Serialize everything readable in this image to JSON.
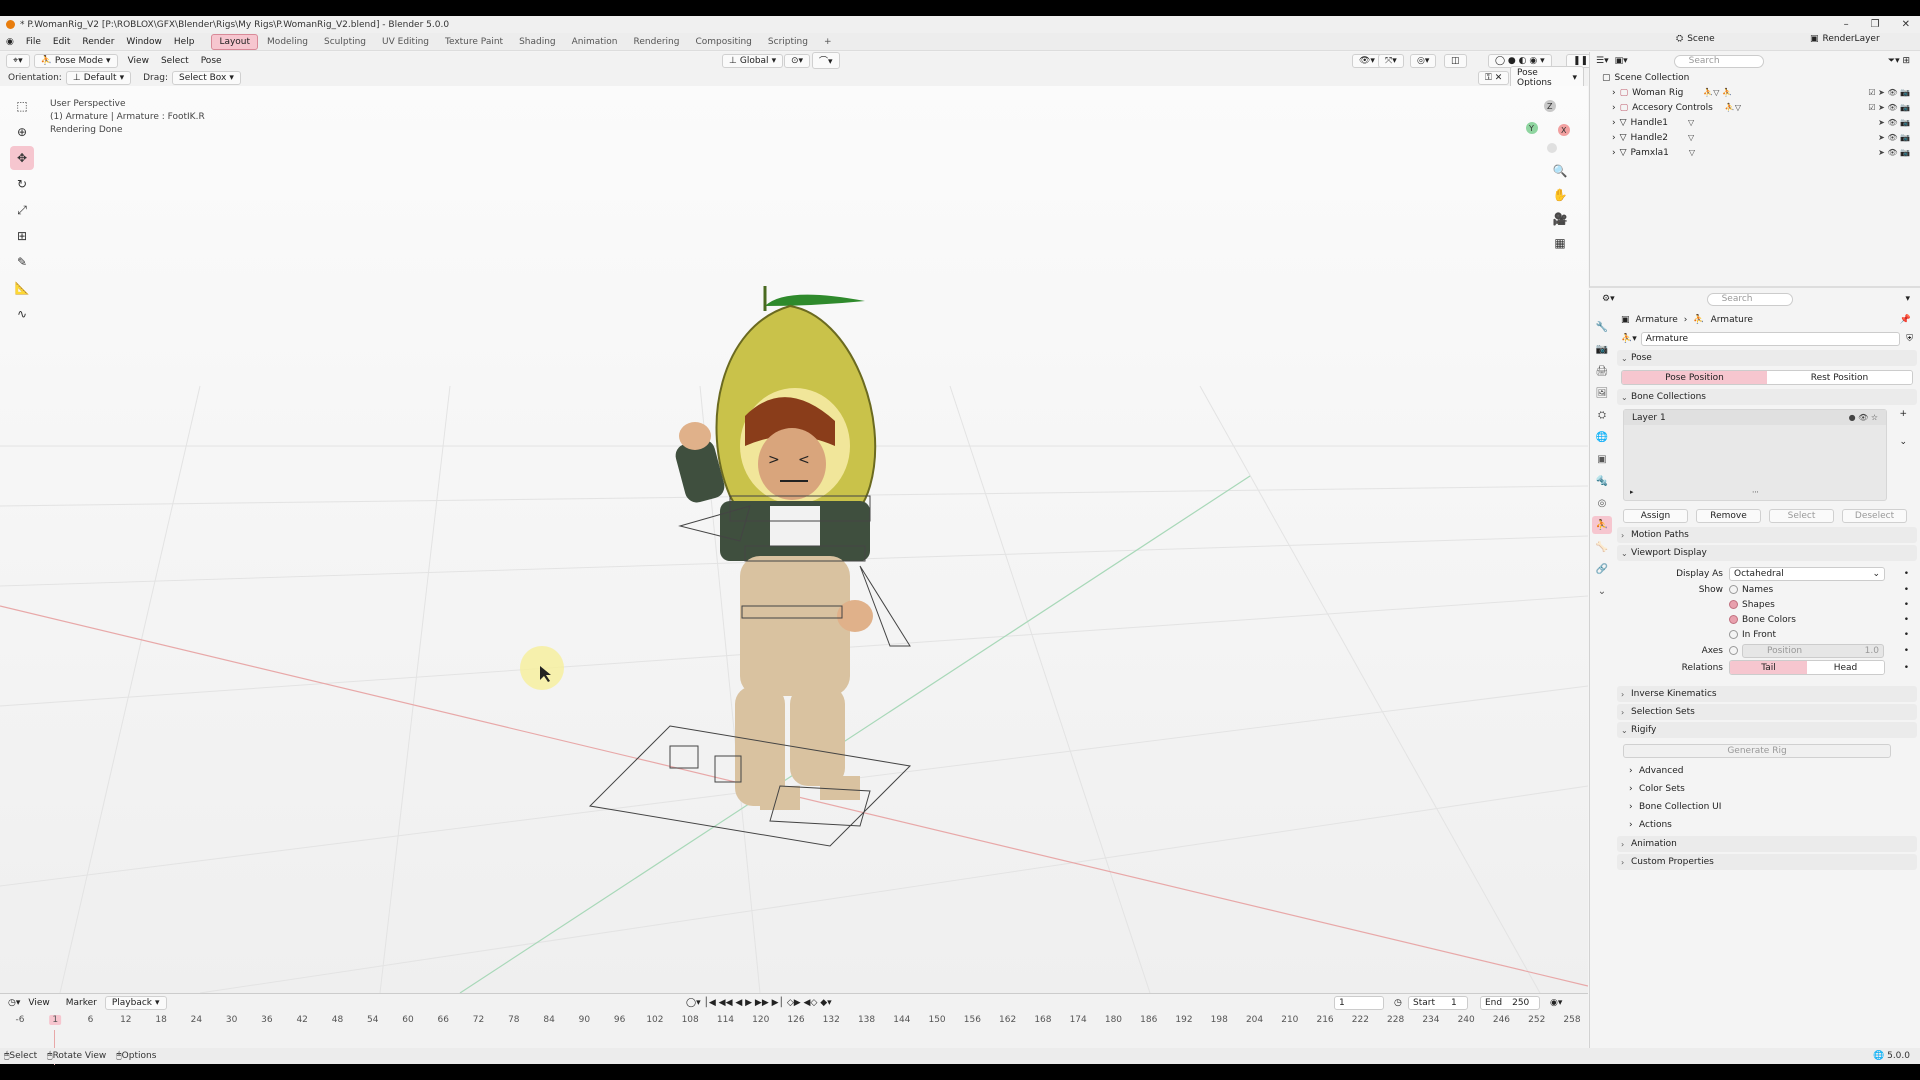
{
  "window": {
    "title": "* P.WomanRig_V2 [P:\\ROBLOX\\GFX\\Blender\\Rigs\\My Rigs\\P.WomanRig_V2.blend] - Blender 5.0.0",
    "controls": [
      "–",
      "❐",
      "✕"
    ]
  },
  "menu": {
    "items": [
      "File",
      "Edit",
      "Render",
      "Window",
      "Help"
    ],
    "workspaces": [
      "Layout",
      "Modeling",
      "Sculpting",
      "UV Editing",
      "Texture Paint",
      "Shading",
      "Animation",
      "Rendering",
      "Compositing",
      "Scripting"
    ],
    "active_workspace": "Layout",
    "scene": "Scene",
    "view_layer": "RenderLayer"
  },
  "viewport_header": {
    "mode": "Pose Mode",
    "menus": [
      "View",
      "Select",
      "Pose"
    ],
    "transform": "Global",
    "orientation_label": "Orientation:",
    "orientation_value": "Default",
    "drag_label": "Drag:",
    "drag_value": "Select Box",
    "pose_options": "Pose Options"
  },
  "viewport": {
    "line1": "User Perspective",
    "line2": "(1) Armature | Armature : FootIK.R",
    "line3": "Rendering Done",
    "gizmo_axes": [
      "Z",
      "Y",
      "X"
    ],
    "colors": {
      "x_axis": "#e8a8a8",
      "y_axis": "#a8d8b8",
      "accent": "#f6c6cf"
    }
  },
  "timeline": {
    "menus": [
      "View",
      "Marker",
      "Playback"
    ],
    "current_frame": "1",
    "start_label": "Start",
    "start": "1",
    "end_label": "End",
    "end": "250",
    "ticks": [
      "-6",
      "1",
      "6",
      "12",
      "18",
      "24",
      "30",
      "36",
      "42",
      "48",
      "54",
      "60",
      "66",
      "72",
      "78",
      "84",
      "90",
      "96",
      "102",
      "108",
      "114",
      "120",
      "126",
      "132",
      "138",
      "144",
      "150",
      "156",
      "162",
      "168",
      "174",
      "180",
      "186",
      "192",
      "198",
      "204",
      "210",
      "216",
      "222",
      "228",
      "234",
      "240",
      "246",
      "252",
      "258"
    ]
  },
  "status": {
    "select": "Select",
    "rotate": "Rotate View",
    "options": "Options",
    "version": "5.0.0"
  },
  "outliner": {
    "search_placeholder": "Search",
    "root": "Scene Collection",
    "items": [
      "Woman Rig",
      "Accesory Controls",
      "Handle1",
      "Handle2",
      "Pamxla1"
    ]
  },
  "properties": {
    "search_placeholder": "Search",
    "breadcrumb_object": "Armature",
    "breadcrumb_data": "Armature",
    "data_name": "Armature",
    "pose_panel": "Pose",
    "pose_position": "Pose Position",
    "rest_position": "Rest Position",
    "bone_collections": "Bone Collections",
    "layer1": "Layer 1",
    "assign": "Assign",
    "remove": "Remove",
    "select": "Select",
    "deselect": "Deselect",
    "motion_paths": "Motion Paths",
    "viewport_display": "Viewport Display",
    "display_as_label": "Display As",
    "display_as_value": "Octahedral",
    "show_label": "Show",
    "names": "Names",
    "shapes": "Shapes",
    "bone_colors": "Bone Colors",
    "in_front": "In Front",
    "axes_label": "Axes",
    "axes_position": "Position",
    "axes_value": "1.0",
    "relations_label": "Relations",
    "tail": "Tail",
    "head": "Head",
    "inverse_kinematics": "Inverse Kinematics",
    "selection_sets": "Selection Sets",
    "rigify": "Rigify",
    "generate_rig": "Generate Rig",
    "advanced": "Advanced",
    "color_sets": "Color Sets",
    "bone_collection_ui": "Bone Collection UI",
    "actions": "Actions",
    "animation": "Animation",
    "custom_properties": "Custom Properties"
  }
}
